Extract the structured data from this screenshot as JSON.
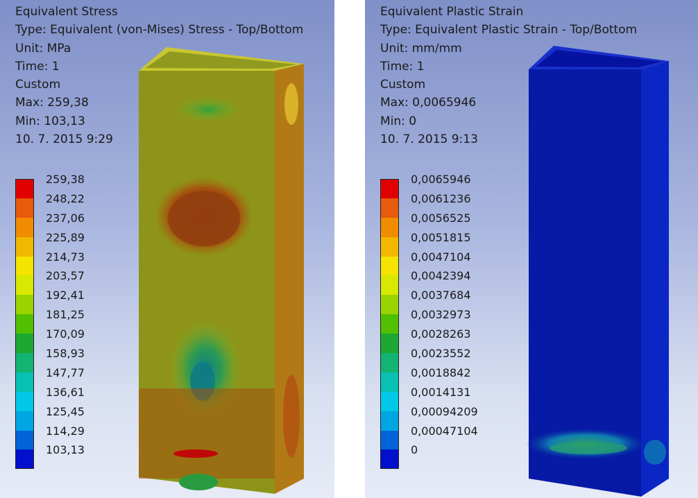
{
  "left_panel": {
    "title": "Equivalent Stress",
    "type": "Type: Equivalent (von-Mises) Stress - Top/Bottom",
    "unit": "Unit: MPa",
    "time": "Time: 1",
    "scale_mode": "Custom",
    "max": "Max: 259,38",
    "min": "Min: 103,13",
    "date": "10. 7. 2015 9:29",
    "legend": [
      {
        "value": "259,38",
        "color": "#e00000"
      },
      {
        "value": "248,22",
        "color": "#e85a0c"
      },
      {
        "value": "237,06",
        "color": "#f08c00"
      },
      {
        "value": "225,89",
        "color": "#f2b800"
      },
      {
        "value": "214,73",
        "color": "#f4e400"
      },
      {
        "value": "203,57",
        "color": "#d8e800"
      },
      {
        "value": "192,41",
        "color": "#9ad400"
      },
      {
        "value": "181,25",
        "color": "#50c000"
      },
      {
        "value": "170,09",
        "color": "#1ca832"
      },
      {
        "value": "158,93",
        "color": "#12b474"
      },
      {
        "value": "147,77",
        "color": "#08c0b4"
      },
      {
        "value": "136,61",
        "color": "#00c8e6"
      },
      {
        "value": "125,45",
        "color": "#00a6e4"
      },
      {
        "value": "114,29",
        "color": "#0064d8"
      },
      {
        "value": "103,13",
        "color": "#0010cc"
      }
    ]
  },
  "right_panel": {
    "title": "Equivalent Plastic Strain",
    "type": "Type: Equivalent Plastic Strain - Top/Bottom",
    "unit": "Unit: mm/mm",
    "time": "Time: 1",
    "scale_mode": "Custom",
    "max": "Max: 0,0065946",
    "min": "Min: 0",
    "date": "10. 7. 2015 9:13",
    "legend": [
      {
        "value": "0,0065946",
        "color": "#e00000"
      },
      {
        "value": "0,0061236",
        "color": "#e85a0c"
      },
      {
        "value": "0,0056525",
        "color": "#f08c00"
      },
      {
        "value": "0,0051815",
        "color": "#f2b800"
      },
      {
        "value": "0,0047104",
        "color": "#f4e400"
      },
      {
        "value": "0,0042394",
        "color": "#d8e800"
      },
      {
        "value": "0,0037684",
        "color": "#9ad400"
      },
      {
        "value": "0,0032973",
        "color": "#50c000"
      },
      {
        "value": "0,0028263",
        "color": "#1ca832"
      },
      {
        "value": "0,0023552",
        "color": "#12b474"
      },
      {
        "value": "0,0018842",
        "color": "#08c0b4"
      },
      {
        "value": "0,0014131",
        "color": "#00c8e6"
      },
      {
        "value": "0,00094209",
        "color": "#00a6e4"
      },
      {
        "value": "0,00047104",
        "color": "#0064d8"
      },
      {
        "value": "0",
        "color": "#0010cc"
      }
    ]
  }
}
